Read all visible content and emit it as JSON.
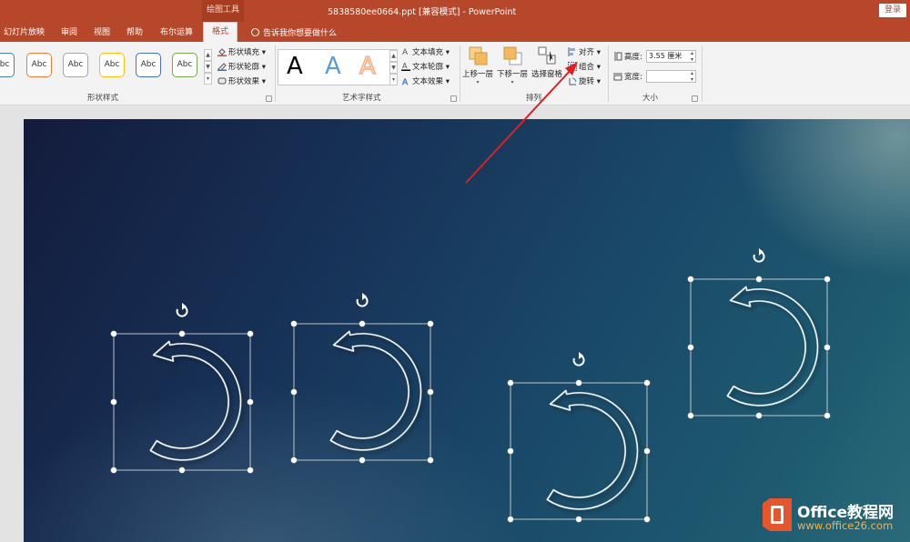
{
  "titlebar": {
    "context_tab": "绘图工具",
    "document_title": "5838580ee0664.ppt [兼容模式]  -  PowerPoint",
    "login_label": "登录"
  },
  "tabs": {
    "items": [
      "幻灯片放映",
      "审阅",
      "视图",
      "帮助",
      "布尔运算"
    ],
    "active": "格式",
    "tell_me": "告诉我你想要做什么"
  },
  "ribbon": {
    "shape_styles": {
      "label": "形状样式",
      "gallery": [
        "Abc",
        "Abc",
        "Abc",
        "Abc",
        "Abc",
        "Abc"
      ],
      "gallery_colors": [
        "#4a7ebb",
        "#ed7d31",
        "#a5a5a5",
        "#ffc000",
        "#4472c4",
        "#70ad47"
      ],
      "fill": "形状填充",
      "outline": "形状轮廓",
      "effects": "形状效果"
    },
    "wordart": {
      "label": "艺术字样式",
      "samples": [
        "A",
        "A",
        "A"
      ],
      "sample_colors": [
        "#000000",
        "#5b9bd5",
        "#f4b183"
      ],
      "text_fill": "文本填充",
      "text_outline": "文本轮廓",
      "text_effects": "文本效果"
    },
    "arrange": {
      "label": "排列",
      "bring_forward": "上移一层",
      "send_backward": "下移一层",
      "selection_pane": "选择窗格",
      "align": "对齐",
      "group": "组合",
      "rotate": "旋转"
    },
    "size": {
      "label": "大小",
      "height_label": "高度:",
      "height_value": "3.55 厘米",
      "width_label": "宽度:",
      "width_value": ""
    }
  },
  "watermark": {
    "brand": "Office教程网",
    "url": "www.office26.com"
  },
  "colors": {
    "accent": "#b7472a",
    "annotation_arrow": "#e02020"
  }
}
